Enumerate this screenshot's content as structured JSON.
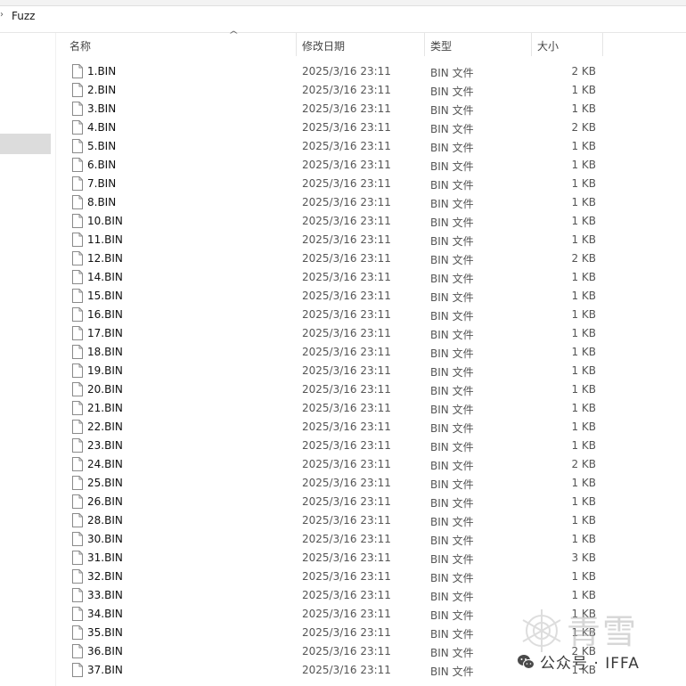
{
  "breadcrumb": {
    "chevron": "›",
    "folder": "Fuzz"
  },
  "columns": {
    "name": "名称",
    "date": "修改日期",
    "type": "类型",
    "size": "大小",
    "sort_arrow": "^"
  },
  "files": [
    {
      "name": "1.BIN",
      "date": "2025/3/16 23:11",
      "type": "BIN 文件",
      "size": "2 KB"
    },
    {
      "name": "2.BIN",
      "date": "2025/3/16 23:11",
      "type": "BIN 文件",
      "size": "1 KB"
    },
    {
      "name": "3.BIN",
      "date": "2025/3/16 23:11",
      "type": "BIN 文件",
      "size": "1 KB"
    },
    {
      "name": "4.BIN",
      "date": "2025/3/16 23:11",
      "type": "BIN 文件",
      "size": "2 KB"
    },
    {
      "name": "5.BIN",
      "date": "2025/3/16 23:11",
      "type": "BIN 文件",
      "size": "1 KB"
    },
    {
      "name": "6.BIN",
      "date": "2025/3/16 23:11",
      "type": "BIN 文件",
      "size": "1 KB"
    },
    {
      "name": "7.BIN",
      "date": "2025/3/16 23:11",
      "type": "BIN 文件",
      "size": "1 KB"
    },
    {
      "name": "8.BIN",
      "date": "2025/3/16 23:11",
      "type": "BIN 文件",
      "size": "1 KB"
    },
    {
      "name": "10.BIN",
      "date": "2025/3/16 23:11",
      "type": "BIN 文件",
      "size": "1 KB"
    },
    {
      "name": "11.BIN",
      "date": "2025/3/16 23:11",
      "type": "BIN 文件",
      "size": "1 KB"
    },
    {
      "name": "12.BIN",
      "date": "2025/3/16 23:11",
      "type": "BIN 文件",
      "size": "2 KB"
    },
    {
      "name": "14.BIN",
      "date": "2025/3/16 23:11",
      "type": "BIN 文件",
      "size": "1 KB"
    },
    {
      "name": "15.BIN",
      "date": "2025/3/16 23:11",
      "type": "BIN 文件",
      "size": "1 KB"
    },
    {
      "name": "16.BIN",
      "date": "2025/3/16 23:11",
      "type": "BIN 文件",
      "size": "1 KB"
    },
    {
      "name": "17.BIN",
      "date": "2025/3/16 23:11",
      "type": "BIN 文件",
      "size": "1 KB"
    },
    {
      "name": "18.BIN",
      "date": "2025/3/16 23:11",
      "type": "BIN 文件",
      "size": "1 KB"
    },
    {
      "name": "19.BIN",
      "date": "2025/3/16 23:11",
      "type": "BIN 文件",
      "size": "1 KB"
    },
    {
      "name": "20.BIN",
      "date": "2025/3/16 23:11",
      "type": "BIN 文件",
      "size": "1 KB"
    },
    {
      "name": "21.BIN",
      "date": "2025/3/16 23:11",
      "type": "BIN 文件",
      "size": "1 KB"
    },
    {
      "name": "22.BIN",
      "date": "2025/3/16 23:11",
      "type": "BIN 文件",
      "size": "1 KB"
    },
    {
      "name": "23.BIN",
      "date": "2025/3/16 23:11",
      "type": "BIN 文件",
      "size": "1 KB"
    },
    {
      "name": "24.BIN",
      "date": "2025/3/16 23:11",
      "type": "BIN 文件",
      "size": "2 KB"
    },
    {
      "name": "25.BIN",
      "date": "2025/3/16 23:11",
      "type": "BIN 文件",
      "size": "1 KB"
    },
    {
      "name": "26.BIN",
      "date": "2025/3/16 23:11",
      "type": "BIN 文件",
      "size": "1 KB"
    },
    {
      "name": "28.BIN",
      "date": "2025/3/16 23:11",
      "type": "BIN 文件",
      "size": "1 KB"
    },
    {
      "name": "30.BIN",
      "date": "2025/3/16 23:11",
      "type": "BIN 文件",
      "size": "1 KB"
    },
    {
      "name": "31.BIN",
      "date": "2025/3/16 23:11",
      "type": "BIN 文件",
      "size": "3 KB"
    },
    {
      "name": "32.BIN",
      "date": "2025/3/16 23:11",
      "type": "BIN 文件",
      "size": "1 KB"
    },
    {
      "name": "33.BIN",
      "date": "2025/3/16 23:11",
      "type": "BIN 文件",
      "size": "1 KB"
    },
    {
      "name": "34.BIN",
      "date": "2025/3/16 23:11",
      "type": "BIN 文件",
      "size": "1 KB"
    },
    {
      "name": "35.BIN",
      "date": "2025/3/16 23:11",
      "type": "BIN 文件",
      "size": "1 KB"
    },
    {
      "name": "36.BIN",
      "date": "2025/3/16 23:11",
      "type": "BIN 文件",
      "size": "2 KB"
    },
    {
      "name": "37.BIN",
      "date": "2025/3/16 23:11",
      "type": "BIN 文件",
      "size": "1 KB"
    }
  ],
  "watermark": {
    "brand": "青雪",
    "text": "公众号 · IFFA"
  },
  "icons": {
    "file": "file-icon",
    "wechat": "wechat-icon",
    "snowflake": "snowflake-icon"
  }
}
